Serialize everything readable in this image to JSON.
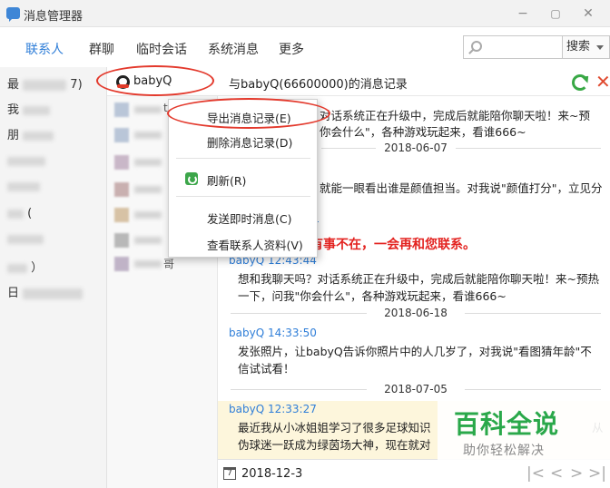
{
  "window": {
    "title": "消息管理器",
    "minimize": "−",
    "restore": "▢",
    "close": "✕"
  },
  "nav": {
    "tabs": [
      "联系人",
      "群聊",
      "临时会话",
      "系统消息",
      "更多"
    ],
    "active_index": 0,
    "search_placeholder": "",
    "search_button": "搜索"
  },
  "left_column": {
    "items": [
      "最",
      "7)",
      "我",
      "朋",
      "(",
      "）",
      "日"
    ]
  },
  "mid_column": {
    "tails": [
      "tao",
      "",
      "",
      "",
      "",
      "哥"
    ]
  },
  "header": {
    "contact_name": "babyQ",
    "record_title": "与babyQ(66600000)的消息记录",
    "close": "✕"
  },
  "messages": {
    "m1_text": "对话系统正在升级中，完成后就能陪你聊天啦！来~预",
    "m1_text2": "你会什么\"，各种游戏玩起来，看谁666~",
    "date1": "2018-06-07",
    "m2_text": "就能一眼看出谁是颜值担当。对我说\"颜值打分\"，立见分",
    "m2_time_frag": "4",
    "m3_red": "有事不在，一会再和您联系。",
    "m4_sender": "babyQ 12:43:44",
    "m4_text": "想和我聊天吗？对话系统正在升级中，完成后就能陪你聊天啦！来~预热一下，问我\"你会什么\"，各种游戏玩起来，看谁666~",
    "date2": "2018-06-18",
    "m5_sender": "babyQ 14:33:50",
    "m5_text": "发张照片，让babyQ告诉你照片中的人几岁了，对我说\"看图猜年龄\"不信试试看！",
    "date3": "2018-07-05",
    "m6_sender": "babyQ 12:33:27",
    "m6_text1": "最近我从小冰姐姐学习了很多足球知识",
    "m6_tail1": "从",
    "m6_text2": "伪球迷一跃成为绿茵场大神，现在就对"
  },
  "context_menu": {
    "export": "导出消息记录(E)",
    "delete": "删除消息记录(D)",
    "refresh": "刷新(R)",
    "send_instant": "发送即时消息(C)",
    "view_profile": "查看联系人资料(V)"
  },
  "bottom": {
    "calendar_glyph": "7",
    "date": "2018-12-3",
    "first": "|<",
    "prev": "<",
    "next": ">",
    "last": ">|"
  },
  "watermark": {
    "title": "百科全说",
    "subtitle": "助你轻松解决"
  },
  "colors": {
    "accent": "#2f7ed8",
    "annotation_red": "#e3392c",
    "watermark_green": "#2aa84a"
  }
}
